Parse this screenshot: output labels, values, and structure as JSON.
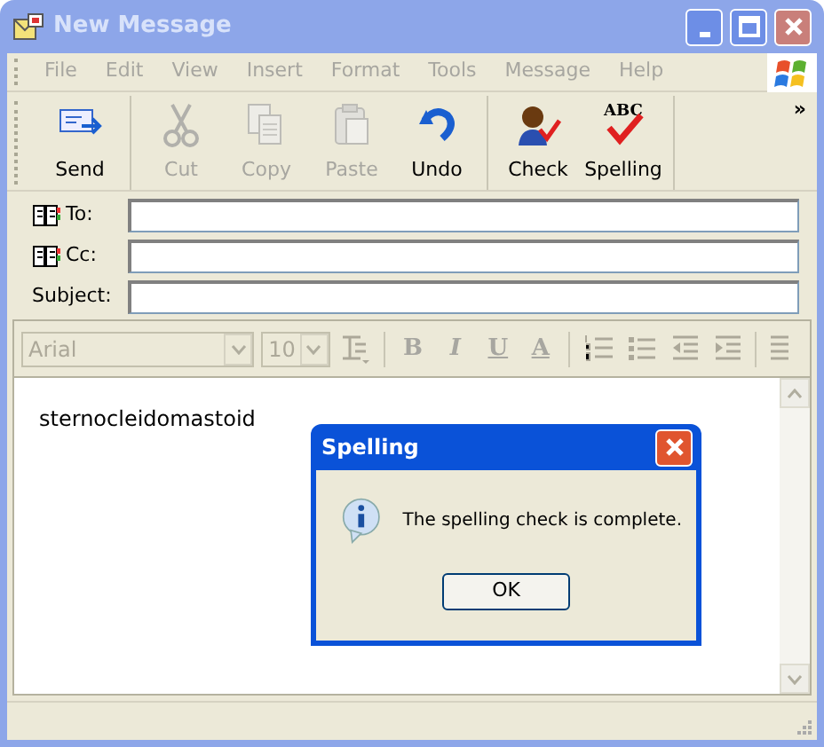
{
  "window": {
    "title": "New Message",
    "active": false
  },
  "menu": [
    {
      "label": "File",
      "disabled": true
    },
    {
      "label": "Edit",
      "disabled": true
    },
    {
      "label": "View",
      "disabled": true
    },
    {
      "label": "Insert",
      "disabled": true
    },
    {
      "label": "Format",
      "disabled": true
    },
    {
      "label": "Tools",
      "disabled": true
    },
    {
      "label": "Message",
      "disabled": true
    },
    {
      "label": "Help",
      "disabled": true
    }
  ],
  "toolbar": {
    "groups": [
      [
        {
          "label": "Send",
          "kind": "send",
          "disabled": false
        }
      ],
      [
        {
          "label": "Cut",
          "kind": "cut",
          "disabled": true
        },
        {
          "label": "Copy",
          "kind": "copy",
          "disabled": true
        },
        {
          "label": "Paste",
          "kind": "paste",
          "disabled": true
        },
        {
          "label": "Undo",
          "kind": "undo",
          "disabled": false
        }
      ],
      [
        {
          "label": "Check",
          "kind": "check",
          "disabled": false
        },
        {
          "label": "Spelling",
          "kind": "spelling",
          "disabled": false,
          "icon_text": "ABC"
        }
      ]
    ],
    "overflow": "»"
  },
  "fields": [
    {
      "label": "To:",
      "kind": "address"
    },
    {
      "label": "Cc:",
      "kind": "address"
    },
    {
      "label": "Subject:",
      "kind": "plain"
    }
  ],
  "format_toolbar": {
    "disabled": true,
    "font": "Arial",
    "size": "10",
    "buttons": [
      {
        "kind": "paragraph"
      },
      {
        "kind": "separator"
      },
      {
        "kind": "bold",
        "label": "B"
      },
      {
        "kind": "italic",
        "label": "I"
      },
      {
        "kind": "underline",
        "label": "U"
      },
      {
        "kind": "font_color",
        "label": "A"
      },
      {
        "kind": "separator"
      },
      {
        "kind": "numbered"
      },
      {
        "kind": "bullets"
      },
      {
        "kind": "outdent"
      },
      {
        "kind": "indent"
      },
      {
        "kind": "separator"
      },
      {
        "kind": "align"
      }
    ]
  },
  "body": {
    "text": "sternocleidomastoid"
  },
  "dialog": {
    "title": "Spelling",
    "message": "The spelling check is complete.",
    "button": "OK"
  }
}
